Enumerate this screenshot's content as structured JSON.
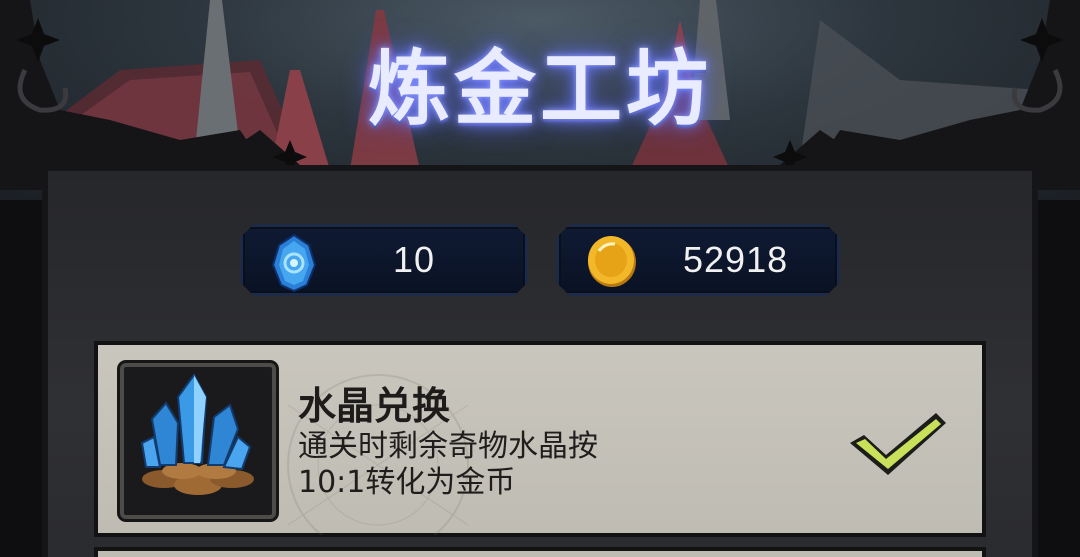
{
  "header": {
    "title": "炼金工坊"
  },
  "currencies": {
    "crystal": {
      "icon": "crystal-egg-icon",
      "value": "10"
    },
    "coin": {
      "icon": "gold-coin-icon",
      "value": "52918"
    }
  },
  "cards": [
    {
      "icon": "crystal-pile-icon",
      "title": "水晶兑换",
      "desc_line1": "通关时剩余奇物水晶按",
      "desc_line2": "10:1转化为金币",
      "status_icon": "checkmark-icon"
    }
  ],
  "colors": {
    "title_glow": "#6e7cff",
    "currency_bg": "#0f1a33",
    "card_bg": "#c9c6bd",
    "check": "#c8e05a"
  }
}
